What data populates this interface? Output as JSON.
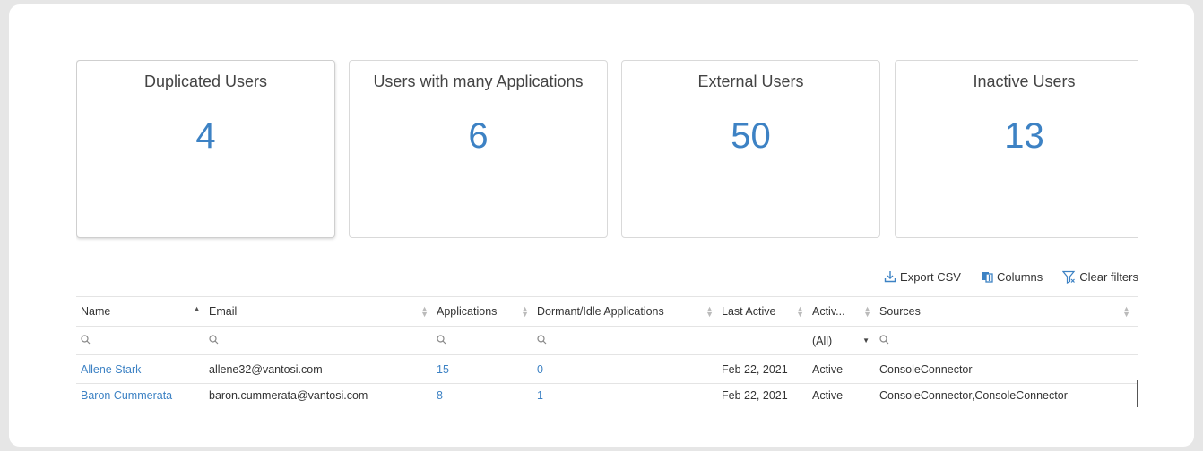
{
  "cards": [
    {
      "title": "Duplicated Users",
      "value": "4"
    },
    {
      "title": "Users with many Applications",
      "value": "6"
    },
    {
      "title": "External Users",
      "value": "50"
    },
    {
      "title": "Inactive Users",
      "value": "13"
    }
  ],
  "toolbar": {
    "export_label": "Export CSV",
    "columns_label": "Columns",
    "clear_label": "Clear filters"
  },
  "table": {
    "headers": {
      "name": "Name",
      "email": "Email",
      "applications": "Applications",
      "dormant": "Dormant/Idle Applications",
      "last_active": "Last Active",
      "active": "Activ...",
      "sources": "Sources"
    },
    "filters": {
      "active_select": "(All)"
    },
    "rows": [
      {
        "name": "Allene Stark",
        "email": "allene32@vantosi.com",
        "applications": "15",
        "dormant": "0",
        "last_active": "Feb 22, 2021",
        "active": "Active",
        "sources": "ConsoleConnector"
      },
      {
        "name": "Baron Cummerata",
        "email": "baron.cummerata@vantosi.com",
        "applications": "8",
        "dormant": "1",
        "last_active": "Feb 22, 2021",
        "active": "Active",
        "sources": "ConsoleConnector,ConsoleConnector"
      }
    ]
  },
  "colors": {
    "accent": "#3d82c4",
    "background": "#e6e6e6",
    "panel": "#ffffff"
  },
  "icons": [
    "download-icon",
    "columns-icon",
    "filter-clear-icon",
    "search-icon",
    "sort-icon",
    "dropdown-caret-icon"
  ]
}
